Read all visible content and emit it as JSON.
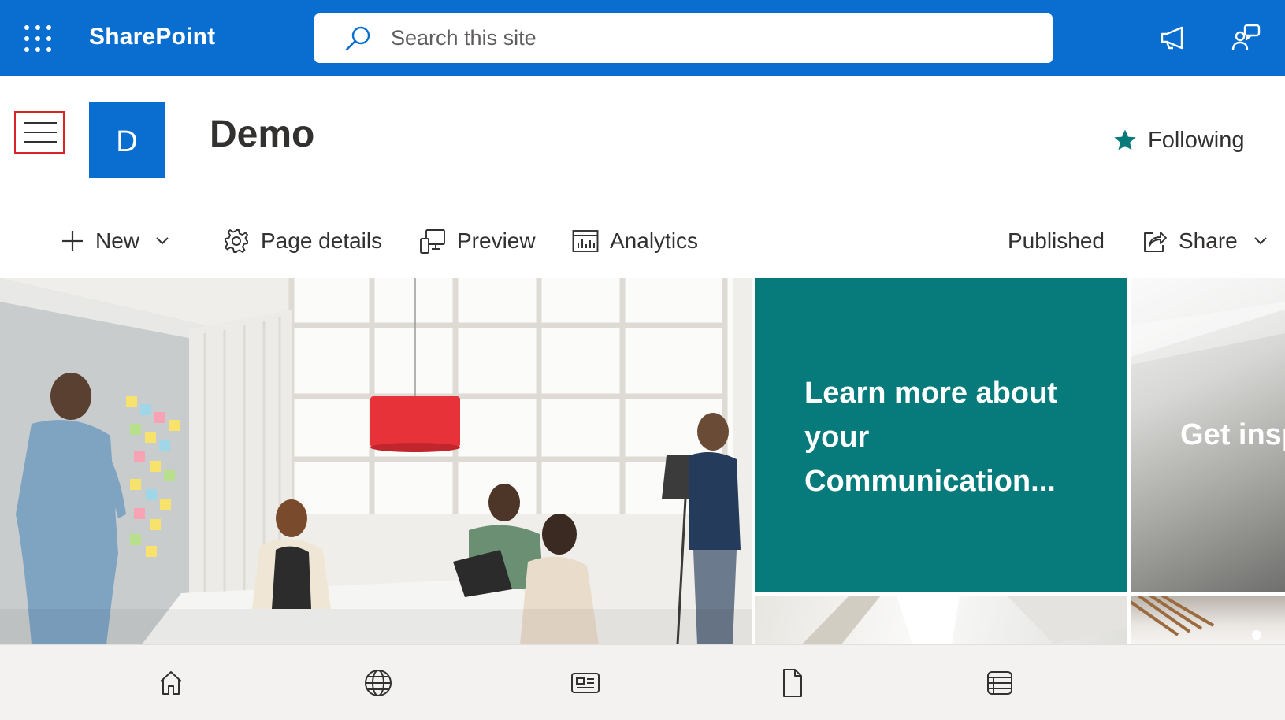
{
  "suite_bar": {
    "app_name": "SharePoint",
    "search": {
      "placeholder": "Search this site"
    },
    "icons": [
      "app-launcher-icon",
      "search-icon",
      "megaphone-icon",
      "chat-help-icon"
    ],
    "accent_color": "#0a6ed1"
  },
  "site_header": {
    "logo_letter": "D",
    "title": "Demo",
    "follow_label": "Following",
    "follow_star_color": "#077b7c"
  },
  "command_bar": {
    "new_label": "New",
    "page_details_label": "Page details",
    "preview_label": "Preview",
    "analytics_label": "Analytics",
    "status_label": "Published",
    "share_label": "Share"
  },
  "hero": {
    "tiles": [
      {
        "text": "Learn more about your Communication...",
        "color": "#077b7c"
      },
      {
        "text": "Get insp the Sha look bo"
      }
    ]
  },
  "bottom_nav": {
    "items": [
      "home-icon",
      "globe-icon",
      "news-icon",
      "document-icon",
      "list-icon"
    ]
  }
}
